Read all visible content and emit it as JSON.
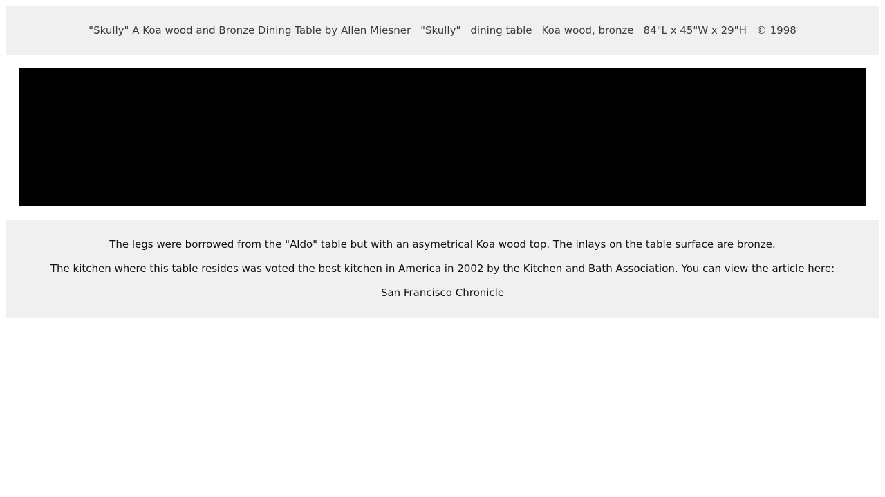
{
  "header": {
    "title": "\"Skully\" A Koa wood and Bronze Dining Table by Allen Miesner",
    "name": "\"Skully\"",
    "type": "dining table",
    "materials": "Koa wood, bronze",
    "dimensions": "84\"L x 45\"W x 29\"H",
    "copyright": "© 1998"
  },
  "description": {
    "paragraph1": "The legs were borrowed from the \"Aldo\" table but with an asymetrical Koa wood top. The inlays on the table surface are bronze.",
    "paragraph2": "The kitchen where this table resides was voted the best kitchen in America in 2002 by the Kitchen and Bath Association. You can view the article here:",
    "link_label": "San Francisco Chronicle"
  }
}
